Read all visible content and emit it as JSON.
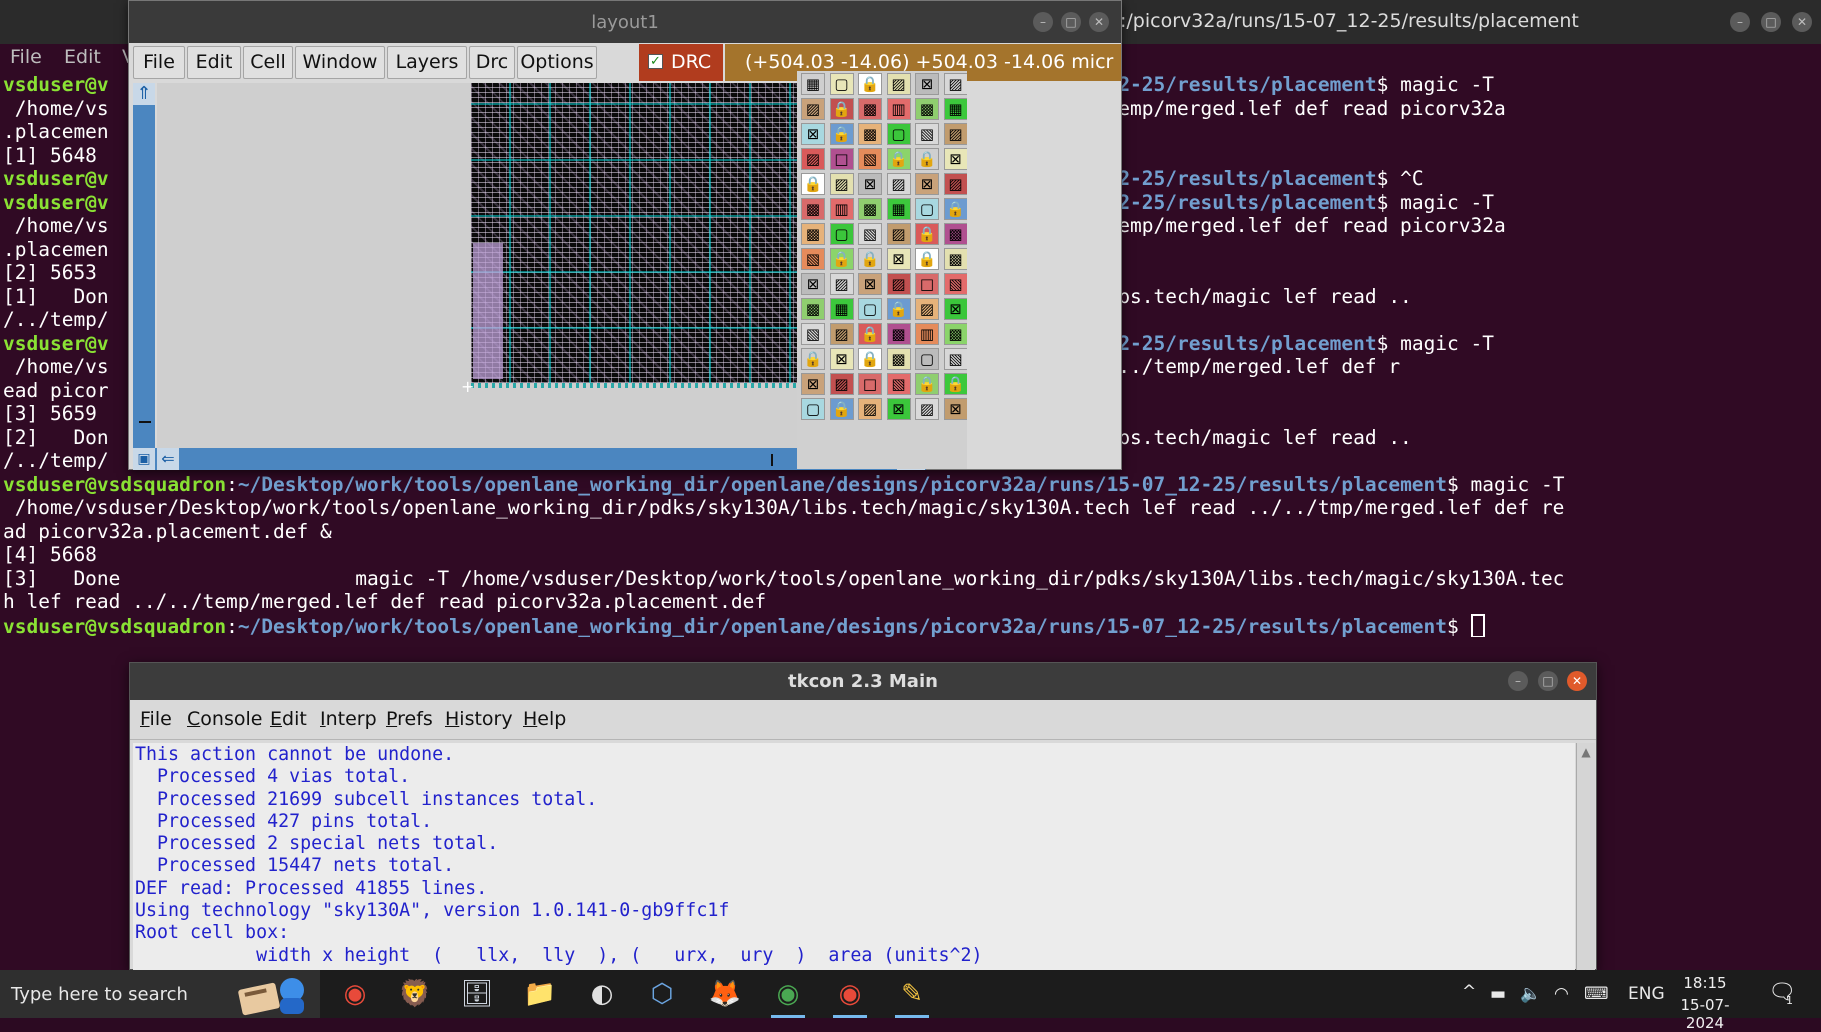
{
  "terminal": {
    "title": ":/picorv32a/runs/15-07_12-25/results/placement",
    "menu": [
      "File",
      "Edit",
      "V"
    ],
    "prompt_user": "vsduser@vsdsquadron",
    "lines": [
      [
        {
          "c": "pu",
          "t": "vsduser@v"
        },
        {
          "c": "",
          "t": "                                                                    "
        },
        {
          "c": "pp",
          "t": "rv32a/runs/15-07_12-25/results/placement"
        },
        {
          "c": "",
          "t": "$ magic -T"
        }
      ],
      [
        {
          "c": "",
          "t": " /home/vs                                                                      lef read ../../temp/merged.lef def read picorv32a"
        }
      ],
      [
        {
          "c": "",
          "t": ".placemen"
        }
      ],
      [
        {
          "c": "",
          "t": "[1] 5648"
        }
      ],
      [
        {
          "c": "pu",
          "t": "vsduser@v"
        },
        {
          "c": "",
          "t": "                                                                    "
        },
        {
          "c": "pp",
          "t": "rv32a/runs/15-07_12-25/results/placement"
        },
        {
          "c": "",
          "t": "$ ^C"
        }
      ],
      [
        {
          "c": "pu",
          "t": "vsduser@v"
        },
        {
          "c": "",
          "t": "                                                                    "
        },
        {
          "c": "pp",
          "t": "rv32a/runs/15-07_12-25/results/placement"
        },
        {
          "c": "",
          "t": "$ magic -T"
        }
      ],
      [
        {
          "c": "",
          "t": " /home/vs                                                                      lef read ../../temp/merged.lef def read picorv32a"
        }
      ],
      [
        {
          "c": "",
          "t": ".placemen"
        }
      ],
      [
        {
          "c": "",
          "t": "[2] 5653"
        }
      ],
      [
        {
          "c": "",
          "t": "[1]   Don                                                             rking_dir/pdks/sky130A/libs.tech/magic lef read .."
        }
      ],
      [
        {
          "c": "",
          "t": "/../temp/"
        }
      ],
      [
        {
          "c": "pu",
          "t": "vsduser@v"
        },
        {
          "c": "",
          "t": "                                                                    "
        },
        {
          "c": "pp",
          "t": "rv32a/runs/15-07_12-25/results/placement"
        },
        {
          "c": "",
          "t": "$ magic -T"
        }
      ],
      [
        {
          "c": "",
          "t": " /home/vs                                                            /sky130A.tech lef read ../../temp/merged.lef def r"
        }
      ],
      [
        {
          "c": "",
          "t": "ead picor"
        }
      ],
      [
        {
          "c": "",
          "t": "[3] 5659"
        }
      ],
      [
        {
          "c": "",
          "t": "[2]   Don                                                             rking_dir/pdks/sky130A/libs.tech/magic lef read .."
        }
      ],
      [
        {
          "c": "",
          "t": "/../temp/"
        }
      ],
      [
        {
          "c": "pu",
          "t": "vsduser@vsdsquadron"
        },
        {
          "c": "",
          "t": ":"
        },
        {
          "c": "pp",
          "t": "~/Desktop/work/tools/openlane_working_dir/openlane/designs/picorv32a/runs/15-07_12-25/results/placement"
        },
        {
          "c": "",
          "t": "$ magic -T"
        }
      ],
      [
        {
          "c": "",
          "t": " /home/vsduser/Desktop/work/tools/openlane_working_dir/pdks/sky130A/libs.tech/magic/sky130A.tech lef read ../../tmp/merged.lef def re"
        }
      ],
      [
        {
          "c": "",
          "t": "ad picorv32a.placement.def &"
        }
      ],
      [
        {
          "c": "",
          "t": "[4] 5668"
        }
      ],
      [
        {
          "c": "",
          "t": "[3]   Done                    magic -T /home/vsduser/Desktop/work/tools/openlane_working_dir/pdks/sky130A/libs.tech/magic/sky130A.tec"
        }
      ],
      [
        {
          "c": "",
          "t": "h lef read ../../temp/merged.lef def read picorv32a.placement.def"
        }
      ],
      [
        {
          "c": "pu",
          "t": "vsduser@vsdsquadron"
        },
        {
          "c": "",
          "t": ":"
        },
        {
          "c": "pp",
          "t": "~/Desktop/work/tools/openlane_working_dir/openlane/designs/picorv32a/runs/15-07_12-25/results/placement"
        },
        {
          "c": "",
          "t": "$ "
        },
        {
          "c": "cursor",
          "t": ""
        }
      ]
    ]
  },
  "layout_window": {
    "title": "layout1",
    "menu": [
      "File",
      "Edit",
      "Cell",
      "Window",
      "Layers",
      "Drc",
      "Options"
    ],
    "drc_label": "DRC",
    "drc_checked": true,
    "coords": "(+504.03 -14.06) +504.03 -14.06 micr",
    "colors": {
      "coord_bg": "#a4742c",
      "drc_bg": "#b13c1e",
      "scroll": "#4b86c0"
    }
  },
  "tkcon": {
    "title": "tkcon 2.3 Main",
    "menu": [
      {
        "u": "F",
        "rest": "ile"
      },
      {
        "u": "C",
        "rest": "onsole"
      },
      {
        "u": "E",
        "rest": "dit"
      },
      {
        "u": "I",
        "rest": "nterp"
      },
      {
        "u": "P",
        "rest": "refs"
      },
      {
        "u": "H",
        "rest": "istory"
      },
      {
        "u": "H",
        "rest": "elp"
      }
    ],
    "lines": [
      "This action cannot be undone.",
      "  Processed 4 vias total.",
      "  Processed 21699 subcell instances total.",
      "  Processed 427 pins total.",
      "  Processed 2 special nets total.",
      "  Processed 15447 nets total.",
      "DEF read: Processed 41855 lines.",
      "Using technology \"sky130A\", version 1.0.141-0-gb9ffc1f",
      "Root cell box:",
      "           width x height  (   llx,  lly  ), (   urx,  ury  )  area (units^2)"
    ],
    "text_color": "#2222cc"
  },
  "taskbar": {
    "search_placeholder": "Type here to search",
    "apps": [
      "chrome-icon",
      "brave-icon",
      "file-server-icon",
      "file-explorer-icon",
      "clock-app-icon",
      "virtualbox-icon",
      "firefox-icon",
      "chrome-profile-icon",
      "chrome-icon-2",
      "editor-icon"
    ],
    "language": "ENG",
    "time": "18:15",
    "date": "15-07-2024",
    "notification_count": "1"
  }
}
